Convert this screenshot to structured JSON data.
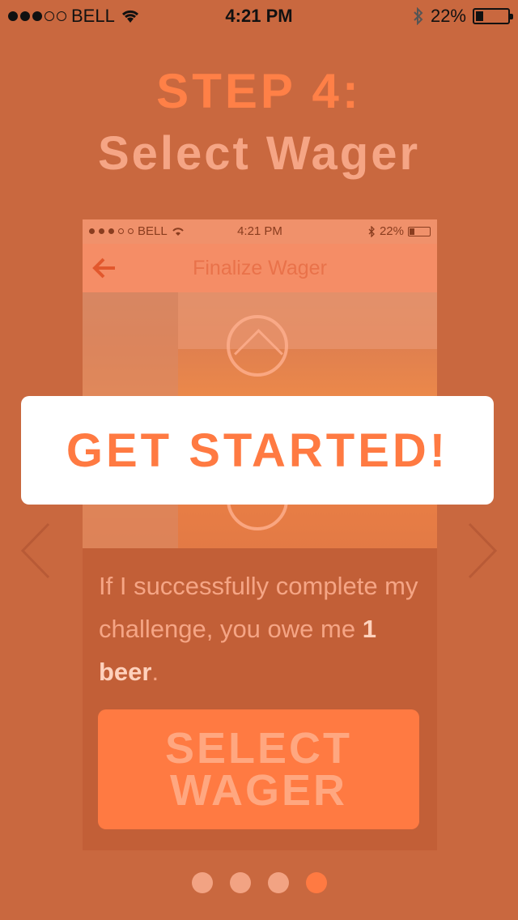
{
  "status_bar": {
    "carrier": "BELL",
    "time": "4:21 PM",
    "battery": "22%"
  },
  "header": {
    "step": "STEP 4:",
    "subtitle": "Select Wager"
  },
  "preview": {
    "status_bar": {
      "carrier": "BELL",
      "time": "4:21 PM",
      "battery": "22%"
    },
    "nav_title": "Finalize Wager",
    "wager_text_prefix": "If I successfully complete my challenge, you owe me ",
    "wager_amount": "1 beer",
    "wager_suffix": ".",
    "select_button_line1": "SELECT",
    "select_button_line2": "WAGER"
  },
  "cta": {
    "label": "GET STARTED!"
  },
  "pager": {
    "count": 4,
    "active_index": 3
  },
  "colors": {
    "background": "#c9683f",
    "accent": "#ff7a42",
    "cta_background": "#ffffff"
  }
}
